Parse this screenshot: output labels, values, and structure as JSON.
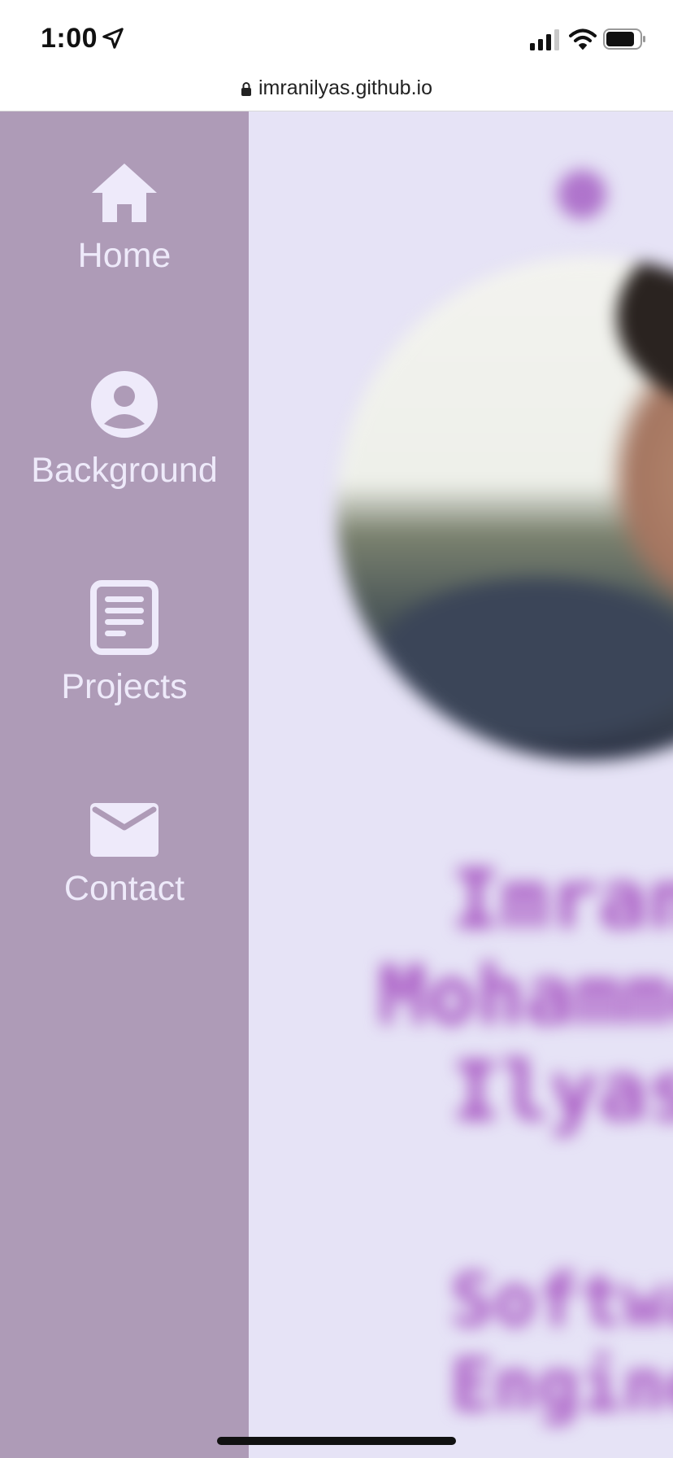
{
  "status_bar": {
    "time": "1:00",
    "icons": [
      "location-arrow-icon",
      "cellular-signal-icon",
      "wifi-icon",
      "battery-icon"
    ]
  },
  "browser": {
    "url": "imranilyas.github.io",
    "lock_icon": "lock-icon"
  },
  "sidebar": {
    "background": "#ae9bb7",
    "text_color": "#eeeafa",
    "items": [
      {
        "label": "Home",
        "icon": "home-icon"
      },
      {
        "label": "Background",
        "icon": "user-circle-icon"
      },
      {
        "label": "Projects",
        "icon": "document-icon"
      },
      {
        "label": "Contact",
        "icon": "envelope-icon"
      }
    ]
  },
  "main": {
    "background": "#e6e3f6",
    "accent": "#a44fc0",
    "name_lines": [
      "Imran",
      "Mohammed",
      "Ilyas"
    ],
    "role_lines": [
      "Software",
      "Engineer"
    ]
  }
}
